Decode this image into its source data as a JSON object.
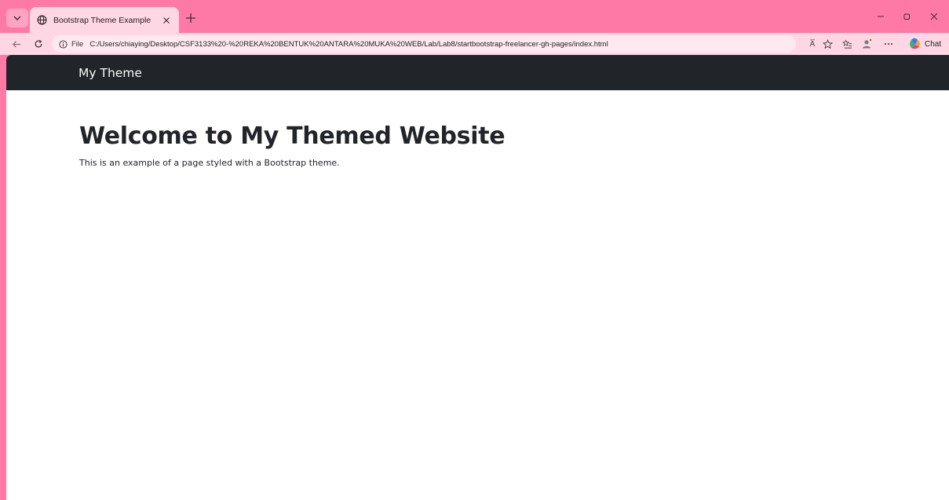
{
  "browser": {
    "tab": {
      "title": "Bootstrap Theme Example"
    },
    "address": {
      "scheme": "File",
      "url": "C:/Users/chiaying/Desktop/CSF3133%20-%20REKA%20BENTUK%20ANTARA%20MUKA%20WEB/Lab/Lab8/startbootstrap-freelancer-gh-pages/index.html"
    },
    "toolbar": {
      "read_aloud": "A̅",
      "copilot_label": "Chat"
    },
    "colors": {
      "frame": "#ff79a6",
      "tab_active": "#ffd6e4",
      "address_bg": "#ffe9f0"
    }
  },
  "page": {
    "navbar": {
      "brand": "My Theme"
    },
    "main": {
      "heading": "Welcome to My Themed Website",
      "text": "This is an example of a page styled with a Bootstrap theme."
    },
    "colors": {
      "navbar_bg": "#212529",
      "text": "#212529"
    }
  }
}
